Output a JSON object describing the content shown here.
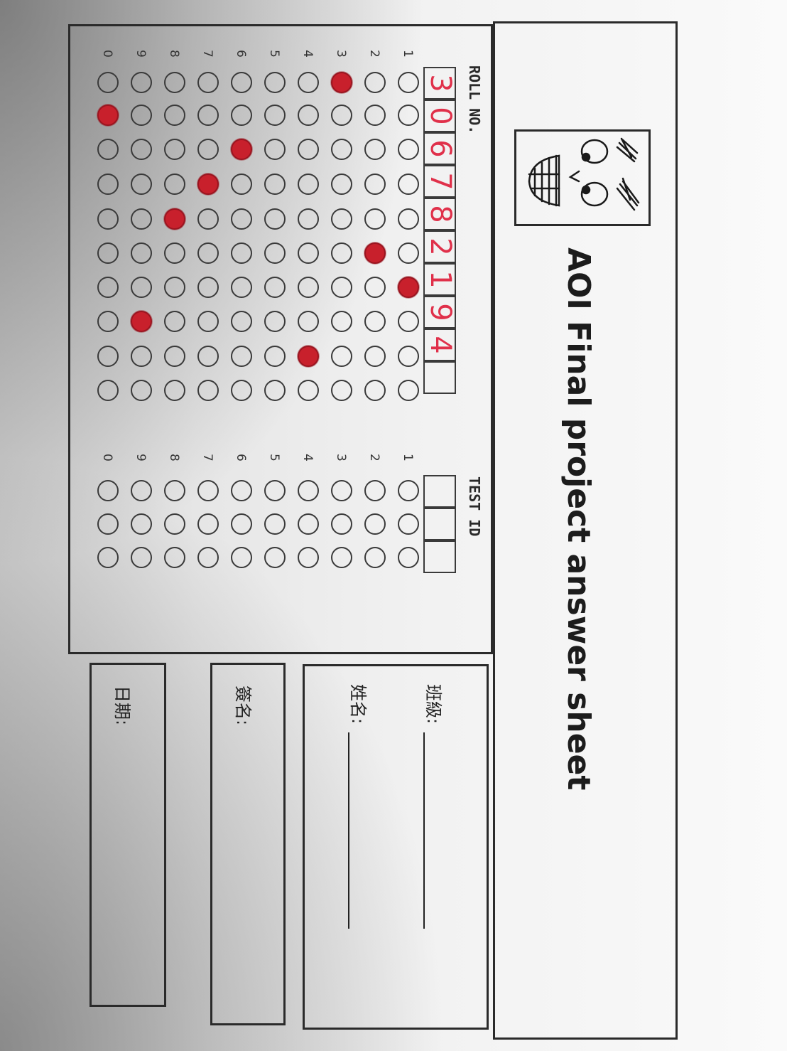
{
  "title": "AOI Final project answer sheet",
  "roll_no": {
    "header": "ROLL NO.",
    "row_labels": [
      "1",
      "2",
      "3",
      "4",
      "5",
      "6",
      "7",
      "8",
      "9",
      "0"
    ],
    "handwritten": [
      "3",
      "0",
      "6",
      "7",
      "8",
      "2",
      "1",
      "9",
      "4",
      ""
    ],
    "marked": [
      {
        "col": 0,
        "digit": "3"
      },
      {
        "col": 1,
        "digit": "0"
      },
      {
        "col": 2,
        "digit": "6"
      },
      {
        "col": 3,
        "digit": "7"
      },
      {
        "col": 4,
        "digit": "8"
      },
      {
        "col": 5,
        "digit": "2"
      },
      {
        "col": 6,
        "digit": "1"
      },
      {
        "col": 7,
        "digit": "9"
      },
      {
        "col": 8,
        "digit": "4"
      }
    ],
    "columns": 10
  },
  "test_id": {
    "header": "TEST ID",
    "row_labels": [
      "1",
      "2",
      "3",
      "4",
      "5",
      "6",
      "7",
      "8",
      "9",
      "0"
    ],
    "columns": 3
  },
  "fields": {
    "class_label": "班級:",
    "name_label": "姓名:",
    "signature_label": "簽名:",
    "date_label": "日期:"
  },
  "colors": {
    "ink_mark": "#c8202c",
    "handwriting": "#e0304a",
    "border": "#2a2a2a"
  }
}
